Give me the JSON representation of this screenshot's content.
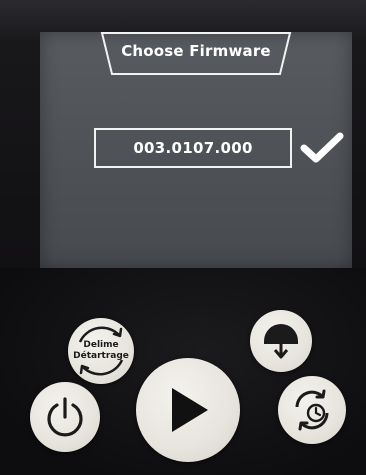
{
  "screen": {
    "title": "Choose Firmware",
    "firmware_version": "003.0107.000",
    "confirm_icon": "checkmark-icon"
  },
  "buttons": {
    "delime": {
      "line1": "Delime",
      "line2": "Détartrage"
    },
    "power": {
      "icon": "power-icon"
    },
    "play": {
      "icon": "play-icon"
    },
    "dispense": {
      "icon": "cup-dispense-icon"
    },
    "timer": {
      "icon": "clock-cycle-icon"
    }
  },
  "colors": {
    "screen_bg": "#53565b",
    "button_face": "#ebe9e3",
    "panel_bg": "#111012",
    "text_on_screen": "#ffffff"
  }
}
